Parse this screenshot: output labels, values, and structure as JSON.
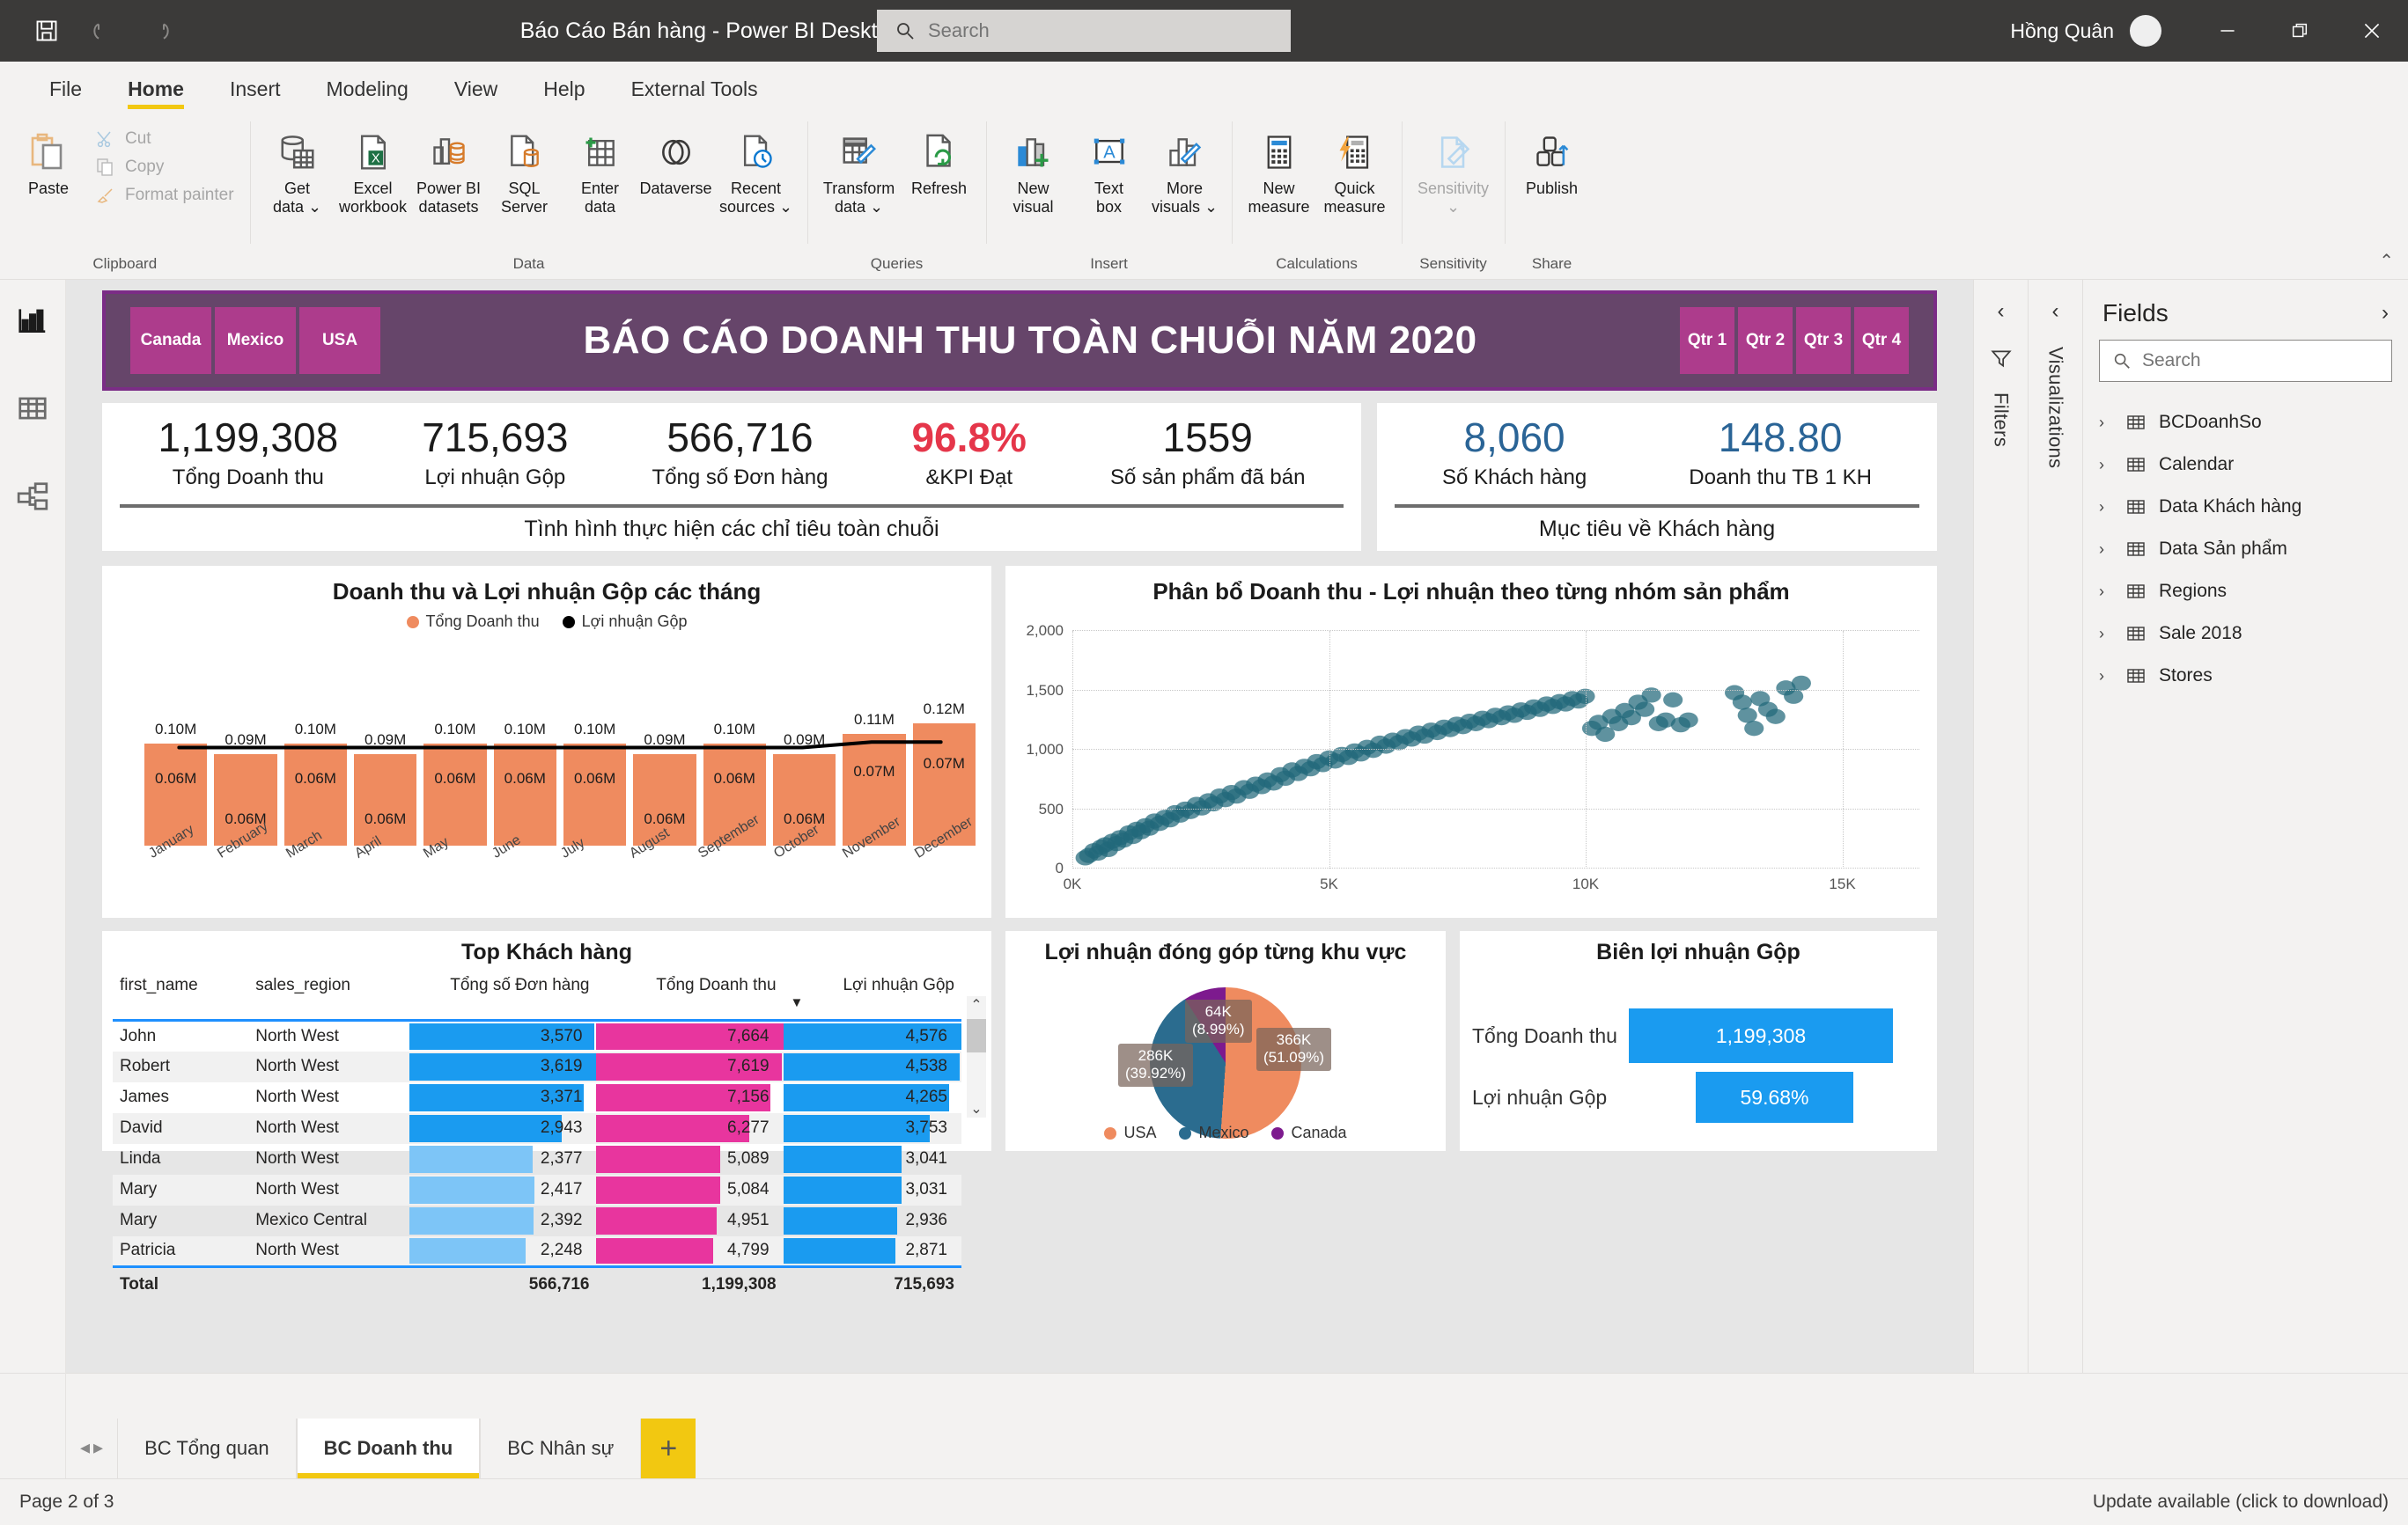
{
  "titlebar": {
    "title": "Báo Cáo Bán hàng - Power BI Desktop",
    "search_placeholder": "Search",
    "user": "Hồng Quân",
    "save_icon": "save-icon",
    "undo_icon": "undo-icon",
    "redo_icon": "redo-icon",
    "minimize": "—",
    "maximize": "❐",
    "close": "✕"
  },
  "ribbon": {
    "tabs": [
      {
        "label": "File",
        "active": false
      },
      {
        "label": "Home",
        "active": true
      },
      {
        "label": "Insert",
        "active": false
      },
      {
        "label": "Modeling",
        "active": false
      },
      {
        "label": "View",
        "active": false
      },
      {
        "label": "Help",
        "active": false
      },
      {
        "label": "External Tools",
        "active": false
      }
    ],
    "groups": [
      {
        "name": "Clipboard",
        "label": "Clipboard"
      },
      {
        "name": "Data",
        "label": "Data"
      },
      {
        "name": "Queries",
        "label": "Queries"
      },
      {
        "name": "Insert",
        "label": "Insert"
      },
      {
        "name": "Calculations",
        "label": "Calculations"
      },
      {
        "name": "Sensitivity",
        "label": "Sensitivity"
      },
      {
        "name": "Share",
        "label": "Share"
      }
    ],
    "clipboard": {
      "paste": "Paste",
      "cut": "Cut",
      "copy": "Copy",
      "format_painter": "Format painter"
    },
    "data_items": [
      {
        "l1": "Get",
        "l2": "data ⌄"
      },
      {
        "l1": "Excel",
        "l2": "workbook"
      },
      {
        "l1": "Power BI",
        "l2": "datasets"
      },
      {
        "l1": "SQL",
        "l2": "Server"
      },
      {
        "l1": "Enter",
        "l2": "data"
      },
      {
        "l1": "Dataverse",
        "l2": ""
      },
      {
        "l1": "Recent",
        "l2": "sources ⌄"
      }
    ],
    "queries_items": [
      {
        "l1": "Transform",
        "l2": "data ⌄"
      },
      {
        "l1": "Refresh",
        "l2": ""
      }
    ],
    "insert_items": [
      {
        "l1": "New",
        "l2": "visual"
      },
      {
        "l1": "Text",
        "l2": "box"
      },
      {
        "l1": "More",
        "l2": "visuals ⌄"
      }
    ],
    "calc_items": [
      {
        "l1": "New",
        "l2": "measure"
      },
      {
        "l1": "Quick",
        "l2": "measure"
      }
    ],
    "sensitivity_item": {
      "l1": "Sensitivity",
      "l2": "⌄"
    },
    "share_item": {
      "l1": "Publish",
      "l2": ""
    }
  },
  "leftrail": [
    {
      "name": "report-view",
      "icon": "bar-chart-icon",
      "active": true
    },
    {
      "name": "data-view",
      "icon": "table-icon",
      "active": false
    },
    {
      "name": "model-view",
      "icon": "model-icon",
      "active": false
    }
  ],
  "report": {
    "title": "BÁO CÁO DOANH THU TOÀN CHUỖI NĂM 2020",
    "country_slicers": [
      "Canada",
      "Mexico",
      "USA"
    ],
    "quarter_slicers": [
      "Qtr 1",
      "Qtr 2",
      "Qtr 3",
      "Qtr 4"
    ],
    "band_color": "#66456a",
    "slicer_color": "#ad3c8c",
    "kpi_left": {
      "footer": "Tình hình thực hiện các chỉ tiêu toàn chuỗi",
      "cards": [
        {
          "value": "1,199,308",
          "label": "Tổng Doanh thu",
          "style": "normal"
        },
        {
          "value": "715,693",
          "label": "Lợi nhuận Gộp",
          "style": "normal"
        },
        {
          "value": "566,716",
          "label": "Tổng số Đơn hàng",
          "style": "normal"
        },
        {
          "value": "96.8%",
          "label": "&KPI Đạt",
          "style": "red"
        },
        {
          "value": "1559",
          "label": "Số sản phẩm đã bán",
          "style": "normal"
        }
      ]
    },
    "kpi_right": {
      "footer": "Mục tiêu về Khách hàng",
      "cards": [
        {
          "value": "8,060",
          "label": "Số Khách hàng",
          "style": "blue"
        },
        {
          "value": "148.80",
          "label": "Doanh thu TB 1 KH",
          "style": "blue"
        }
      ]
    },
    "table_visual": {
      "title": "Top Khách hàng",
      "columns": [
        "first_name",
        "sales_region",
        "Tổng số Đơn hàng",
        "Tổng Doanh thu",
        "Lợi nhuận Gộp"
      ],
      "sort_column_index": 4,
      "sort_indicator": "▼",
      "rows": [
        {
          "first_name": "John",
          "sales_region": "North West",
          "orders": "3,570",
          "revenue": "7,664",
          "profit": "4,576"
        },
        {
          "first_name": "Robert",
          "sales_region": "North West",
          "orders": "3,619",
          "revenue": "7,619",
          "profit": "4,538"
        },
        {
          "first_name": "James",
          "sales_region": "North West",
          "orders": "3,371",
          "revenue": "7,156",
          "profit": "4,265"
        },
        {
          "first_name": "David",
          "sales_region": "North West",
          "orders": "2,943",
          "revenue": "6,277",
          "profit": "3,753"
        },
        {
          "first_name": "Linda",
          "sales_region": "North West",
          "orders": "2,377",
          "revenue": "5,089",
          "profit": "3,041"
        },
        {
          "first_name": "Mary",
          "sales_region": "North West",
          "orders": "2,417",
          "revenue": "5,084",
          "profit": "3,031"
        },
        {
          "first_name": "Mary",
          "sales_region": "Mexico Central",
          "orders": "2,392",
          "revenue": "4,951",
          "profit": "2,936"
        },
        {
          "first_name": "Patricia",
          "sales_region": "North West",
          "orders": "2,248",
          "revenue": "4,799",
          "profit": "2,871"
        }
      ],
      "total": {
        "label": "Total",
        "orders": "566,716",
        "revenue": "1,199,308",
        "profit": "715,693"
      }
    },
    "margin_visual": {
      "title": "Biên lợi nhuận Gộp",
      "rows": [
        {
          "label": "Tổng Doanh thu",
          "value": "1,199,308",
          "pct": 100
        },
        {
          "label": "Lợi nhuận Gộp",
          "value": "59.68%",
          "pct": 59.68
        }
      ],
      "bar_color": "#1a9bf0"
    }
  },
  "chart_data": [
    {
      "type": "bar",
      "name": "monthly-revenue-profit",
      "title": "Doanh thu và Lợi nhuận Gộp các tháng",
      "categories": [
        "January",
        "February",
        "March",
        "April",
        "May",
        "June",
        "July",
        "August",
        "September",
        "October",
        "November",
        "December"
      ],
      "series": [
        {
          "name": "Tổng Doanh thu",
          "type": "bar",
          "color": "#ef8b5f",
          "values": [
            0.1,
            0.09,
            0.1,
            0.09,
            0.1,
            0.1,
            0.1,
            0.09,
            0.1,
            0.09,
            0.11,
            0.12
          ],
          "labels": [
            "0.10M",
            "0.09M",
            "0.10M",
            "0.09M",
            "0.10M",
            "0.10M",
            "0.10M",
            "0.09M",
            "0.10M",
            "0.09M",
            "0.11M",
            "0.12M"
          ]
        },
        {
          "name": "Lợi nhuận Gộp",
          "type": "line",
          "color": "#000000",
          "values": [
            0.06,
            0.06,
            0.06,
            0.06,
            0.06,
            0.06,
            0.06,
            0.06,
            0.06,
            0.06,
            0.07,
            0.07
          ],
          "labels": [
            "0.06M",
            "0.06M",
            "0.06M",
            "0.06M",
            "0.06M",
            "0.06M",
            "0.06M",
            "0.06M",
            "0.06M",
            "0.06M",
            "0.07M",
            "0.07M"
          ],
          "label_above": [
            true,
            false,
            true,
            false,
            true,
            true,
            true,
            false,
            true,
            false,
            true,
            true
          ]
        }
      ],
      "xlabel": "",
      "ylabel": "",
      "units": "M",
      "grid": false,
      "legend": "top"
    },
    {
      "type": "scatter",
      "name": "revenue-profit-by-product-group",
      "title": "Phân bổ Doanh thu - Lợi nhuận theo từng nhóm sản phẩm",
      "xlabel": "",
      "ylabel": "",
      "xlim": [
        0,
        16500
      ],
      "ylim": [
        0,
        2000
      ],
      "xticks": [
        "0K",
        "5K",
        "10K",
        "15K"
      ],
      "yticks": [
        "0",
        "500",
        "1,000",
        "1,500",
        "2,000"
      ],
      "marker_color": "#21687a",
      "grid": true,
      "points": [
        [
          250,
          90
        ],
        [
          320,
          110
        ],
        [
          420,
          150
        ],
        [
          500,
          130
        ],
        [
          560,
          180
        ],
        [
          640,
          200
        ],
        [
          700,
          160
        ],
        [
          780,
          230
        ],
        [
          860,
          210
        ],
        [
          930,
          260
        ],
        [
          1000,
          240
        ],
        [
          1100,
          300
        ],
        [
          1180,
          270
        ],
        [
          1250,
          330
        ],
        [
          1340,
          310
        ],
        [
          1420,
          360
        ],
        [
          1500,
          340
        ],
        [
          1600,
          400
        ],
        [
          1700,
          380
        ],
        [
          1800,
          430
        ],
        [
          1900,
          410
        ],
        [
          2000,
          470
        ],
        [
          2100,
          450
        ],
        [
          2200,
          500
        ],
        [
          2300,
          480
        ],
        [
          2420,
          540
        ],
        [
          2520,
          510
        ],
        [
          2650,
          570
        ],
        [
          2750,
          545
        ],
        [
          2870,
          610
        ],
        [
          2980,
          580
        ],
        [
          3100,
          640
        ],
        [
          3200,
          610
        ],
        [
          3340,
          680
        ],
        [
          3450,
          650
        ],
        [
          3570,
          710
        ],
        [
          3690,
          690
        ],
        [
          3800,
          745
        ],
        [
          3920,
          720
        ],
        [
          4050,
          790
        ],
        [
          4150,
          760
        ],
        [
          4280,
          830
        ],
        [
          4400,
          800
        ],
        [
          4520,
          860
        ],
        [
          4640,
          840
        ],
        [
          4760,
          900
        ],
        [
          4880,
          875
        ],
        [
          5000,
          930
        ],
        [
          5120,
          905
        ],
        [
          5250,
          960
        ],
        [
          5380,
          935
        ],
        [
          5500,
          990
        ],
        [
          5620,
          965
        ],
        [
          5740,
          1020
        ],
        [
          5860,
          995
        ],
        [
          5990,
          1055
        ],
        [
          6110,
          1030
        ],
        [
          6240,
          1080
        ],
        [
          6360,
          1060
        ],
        [
          6490,
          1110
        ],
        [
          6610,
          1090
        ],
        [
          6740,
          1140
        ],
        [
          6860,
          1115
        ],
        [
          6990,
          1165
        ],
        [
          7110,
          1145
        ],
        [
          7240,
          1190
        ],
        [
          7360,
          1170
        ],
        [
          7490,
          1215
        ],
        [
          7610,
          1195
        ],
        [
          7740,
          1240
        ],
        [
          7860,
          1220
        ],
        [
          7990,
          1265
        ],
        [
          8110,
          1245
        ],
        [
          8240,
          1290
        ],
        [
          8360,
          1270
        ],
        [
          8490,
          1310
        ],
        [
          8610,
          1290
        ],
        [
          8740,
          1335
        ],
        [
          8860,
          1315
        ],
        [
          8990,
          1360
        ],
        [
          9110,
          1340
        ],
        [
          9240,
          1385
        ],
        [
          9360,
          1365
        ],
        [
          9490,
          1405
        ],
        [
          9610,
          1385
        ],
        [
          9740,
          1430
        ],
        [
          9860,
          1410
        ],
        [
          9990,
          1450
        ],
        [
          10120,
          1180
        ],
        [
          10250,
          1230
        ],
        [
          10380,
          1130
        ],
        [
          10510,
          1280
        ],
        [
          10640,
          1220
        ],
        [
          10760,
          1330
        ],
        [
          10890,
          1270
        ],
        [
          11020,
          1400
        ],
        [
          11150,
          1340
        ],
        [
          11280,
          1460
        ],
        [
          11420,
          1220
        ],
        [
          11560,
          1250
        ],
        [
          11700,
          1420
        ],
        [
          11850,
          1210
        ],
        [
          12000,
          1250
        ],
        [
          12900,
          1480
        ],
        [
          13050,
          1400
        ],
        [
          13150,
          1290
        ],
        [
          13280,
          1180
        ],
        [
          13400,
          1430
        ],
        [
          13550,
          1340
        ],
        [
          13700,
          1280
        ],
        [
          13900,
          1520
        ],
        [
          14050,
          1450
        ],
        [
          14200,
          1560
        ]
      ]
    },
    {
      "type": "pie",
      "name": "profit-by-region",
      "title": "Lợi nhuận đóng góp từng khu vực",
      "labels": [
        "USA",
        "Mexico",
        "Canada"
      ],
      "values": [
        366,
        286,
        64
      ],
      "value_labels": [
        "366K",
        "286K",
        "64K"
      ],
      "percent_labels": [
        "(51.09%)",
        "(39.92%)",
        "(8.99%)"
      ],
      "percents": [
        51.09,
        39.92,
        8.99
      ],
      "colors": [
        "#ef8b5f",
        "#2b6c8f",
        "#7d1a8e"
      ],
      "legend": "bottom"
    }
  ],
  "rightpanes": {
    "filters_label": "Filters",
    "visualizations_label": "Visualizations",
    "fields_title": "Fields",
    "fields_search_placeholder": "Search",
    "tables": [
      "BCDoanhSo",
      "Calendar",
      "Data Khách hàng",
      "Data Sản phẩm",
      "Regions",
      "Sale 2018",
      "Stores"
    ]
  },
  "pagebar": {
    "tabs": [
      {
        "label": "BC Tổng quan",
        "active": false
      },
      {
        "label": "BC Doanh thu",
        "active": true
      },
      {
        "label": "BC Nhân sự",
        "active": false
      }
    ],
    "add_label": "+"
  },
  "statusbar": {
    "page_indicator": "Page 2 of 3",
    "update_text": "Update available (click to download)"
  }
}
